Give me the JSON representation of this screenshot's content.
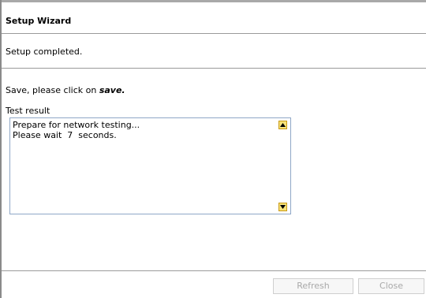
{
  "window": {
    "title": "Setup Wizard"
  },
  "status": {
    "message": "Setup completed."
  },
  "save_hint": {
    "prefix": "Save, please click on ",
    "keyword": "save."
  },
  "test_result": {
    "label": "Test result",
    "lines": "Prepare for network testing...\nPlease wait  7  seconds."
  },
  "icons": {
    "scroll_up": "triangle-up-icon",
    "scroll_down": "triangle-down-icon"
  },
  "buttons": {
    "refresh_label": "Refresh",
    "close_label": "Close",
    "refresh_enabled": false,
    "close_enabled": false
  },
  "colors": {
    "scroll_button_fill": "#f6e27a",
    "scroll_button_border": "#c99a16",
    "textarea_border": "#8fa7c7",
    "disabled_text": "#a9a9a9"
  }
}
